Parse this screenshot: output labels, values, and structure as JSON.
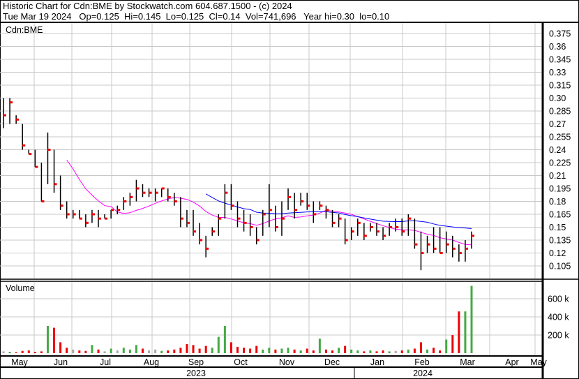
{
  "header": {
    "title": "Historic Chart for Cdn:BME by Stockwatch.com 604.687.1500 - (c) 2024",
    "quote": "Tue Mar 19 2024   Op=0.125  Hi=0.145  Lo=0.125  Cl=0.14  Vol=741,696   Year hi=0.30  lo=0.10"
  },
  "chart_data": {
    "type": "ohlc",
    "symbol": "Cdn:BME",
    "volume_label": "Volume",
    "price_ticks": [
      "0.375",
      "0.36",
      "0.345",
      "0.33",
      "0.315",
      "0.30",
      "0.285",
      "0.27",
      "0.255",
      "0.24",
      "0.225",
      "0.21",
      "0.195",
      "0.18",
      "0.165",
      "0.15",
      "0.135",
      "0.12",
      "0.105"
    ],
    "price_range": [
      0.09,
      0.385
    ],
    "volume_ticks": [
      {
        "v": 600,
        "label": "600 k"
      },
      {
        "v": 400,
        "label": "400 k"
      },
      {
        "v": 200,
        "label": "200 k"
      }
    ],
    "months": [
      "May",
      "Jun",
      "Jul",
      "Aug",
      "Sep",
      "Oct",
      "Nov",
      "Dec",
      "Jan",
      "Feb",
      "Mar",
      "Apr",
      "May"
    ],
    "years": [
      "2023",
      "2024"
    ],
    "moving_averages": [
      {
        "period": 11,
        "color": "#ff00ff"
      },
      {
        "period": 33,
        "color": "#0000ff"
      }
    ],
    "colors": {
      "up": "#44aa44",
      "down": "#ee0000",
      "flat": "#aaaaaa",
      "close_tick": "#ee0000"
    },
    "bars_hlcv": [
      [
        0.3,
        0.265,
        0.28,
        20
      ],
      [
        0.3,
        0.27,
        0.295,
        15
      ],
      [
        0.28,
        0.27,
        0.275,
        10
      ],
      [
        0.27,
        0.24,
        0.245,
        25
      ],
      [
        0.24,
        0.235,
        0.235,
        30
      ],
      [
        0.24,
        0.22,
        0.22,
        15
      ],
      [
        0.225,
        0.18,
        0.18,
        20
      ],
      [
        0.26,
        0.2,
        0.24,
        300
      ],
      [
        0.24,
        0.19,
        0.2,
        280
      ],
      [
        0.21,
        0.17,
        0.175,
        120
      ],
      [
        0.18,
        0.16,
        0.165,
        60
      ],
      [
        0.17,
        0.16,
        0.165,
        40
      ],
      [
        0.17,
        0.16,
        0.16,
        30
      ],
      [
        0.165,
        0.15,
        0.155,
        25
      ],
      [
        0.17,
        0.155,
        0.165,
        90
      ],
      [
        0.17,
        0.15,
        0.16,
        40
      ],
      [
        0.165,
        0.16,
        0.16,
        20
      ],
      [
        0.17,
        0.16,
        0.17,
        50
      ],
      [
        0.175,
        0.165,
        0.17,
        30
      ],
      [
        0.185,
        0.17,
        0.18,
        60
      ],
      [
        0.19,
        0.175,
        0.185,
        40
      ],
      [
        0.205,
        0.18,
        0.195,
        90
      ],
      [
        0.2,
        0.185,
        0.19,
        50
      ],
      [
        0.195,
        0.185,
        0.19,
        30
      ],
      [
        0.195,
        0.18,
        0.19,
        40
      ],
      [
        0.195,
        0.185,
        0.195,
        25
      ],
      [
        0.195,
        0.18,
        0.185,
        30
      ],
      [
        0.19,
        0.175,
        0.18,
        40
      ],
      [
        0.185,
        0.15,
        0.16,
        60
      ],
      [
        0.17,
        0.15,
        0.155,
        100
      ],
      [
        0.17,
        0.14,
        0.145,
        90
      ],
      [
        0.155,
        0.13,
        0.135,
        50
      ],
      [
        0.14,
        0.115,
        0.125,
        80
      ],
      [
        0.15,
        0.14,
        0.145,
        60
      ],
      [
        0.165,
        0.14,
        0.16,
        180
      ],
      [
        0.2,
        0.16,
        0.19,
        300
      ],
      [
        0.2,
        0.17,
        0.175,
        120
      ],
      [
        0.18,
        0.15,
        0.16,
        70
      ],
      [
        0.17,
        0.145,
        0.155,
        60
      ],
      [
        0.165,
        0.14,
        0.15,
        50
      ],
      [
        0.15,
        0.13,
        0.135,
        80
      ],
      [
        0.17,
        0.14,
        0.165,
        40
      ],
      [
        0.2,
        0.15,
        0.17,
        60
      ],
      [
        0.175,
        0.145,
        0.15,
        40
      ],
      [
        0.18,
        0.14,
        0.16,
        50
      ],
      [
        0.195,
        0.17,
        0.185,
        60
      ],
      [
        0.19,
        0.16,
        0.17,
        40
      ],
      [
        0.19,
        0.175,
        0.18,
        30
      ],
      [
        0.19,
        0.17,
        0.175,
        50
      ],
      [
        0.18,
        0.155,
        0.165,
        30
      ],
      [
        0.18,
        0.17,
        0.175,
        160
      ],
      [
        0.175,
        0.16,
        0.17,
        40
      ],
      [
        0.17,
        0.15,
        0.155,
        30
      ],
      [
        0.165,
        0.15,
        0.16,
        60
      ],
      [
        0.16,
        0.13,
        0.135,
        80
      ],
      [
        0.15,
        0.135,
        0.145,
        40
      ],
      [
        0.16,
        0.14,
        0.155,
        30
      ],
      [
        0.155,
        0.135,
        0.14,
        20
      ],
      [
        0.155,
        0.145,
        0.15,
        30
      ],
      [
        0.155,
        0.14,
        0.145,
        20
      ],
      [
        0.15,
        0.135,
        0.14,
        30
      ],
      [
        0.155,
        0.14,
        0.15,
        20
      ],
      [
        0.16,
        0.145,
        0.15,
        25
      ],
      [
        0.16,
        0.14,
        0.145,
        30
      ],
      [
        0.165,
        0.14,
        0.16,
        40
      ],
      [
        0.16,
        0.125,
        0.13,
        50
      ],
      [
        0.145,
        0.1,
        0.12,
        120
      ],
      [
        0.14,
        0.12,
        0.13,
        40
      ],
      [
        0.15,
        0.12,
        0.125,
        60
      ],
      [
        0.15,
        0.12,
        0.12,
        30
      ],
      [
        0.145,
        0.12,
        0.13,
        150
      ],
      [
        0.14,
        0.115,
        0.125,
        200
      ],
      [
        0.13,
        0.11,
        0.12,
        460
      ],
      [
        0.135,
        0.11,
        0.125,
        460
      ],
      [
        0.145,
        0.125,
        0.14,
        742
      ]
    ]
  }
}
